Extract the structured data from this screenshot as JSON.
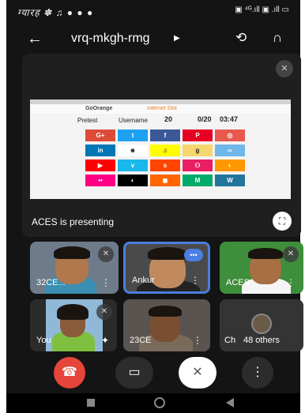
{
  "status": {
    "left": "ग्यारह ✽ ♫ ● ● ●",
    "right": "▣ ⁴ᴳ.ıll ▣ .ıll ▭"
  },
  "topbar": {
    "meeting_code": "vrq-mkgh-rmg",
    "back_icon": "arrow-left-icon",
    "switch_camera_icon": "camera-switch-icon",
    "audio_icon": "headphones-icon"
  },
  "presentation": {
    "label": "ACES is presenting",
    "screen": {
      "brand": "GoOrange",
      "section": "Internet Slot",
      "pretest": "Pretest",
      "user": "Username",
      "score": "20",
      "progress": "0/20",
      "timer": "03:47",
      "cells": [
        {
          "text": "G+",
          "color": "#dd4b39"
        },
        {
          "text": "t",
          "color": "#1da1f2"
        },
        {
          "text": "f",
          "color": "#3b5998"
        },
        {
          "text": "P",
          "color": "#e60023"
        },
        {
          "text": "◎",
          "color": "#e95950"
        },
        {
          "text": "in",
          "color": "#0077b5"
        },
        {
          "text": "☻",
          "color": "#ffffff"
        },
        {
          "text": "♫",
          "color": "#fffc00"
        },
        {
          "text": "g",
          "color": "#f5d76e"
        },
        {
          "text": "∞",
          "color": "#6fb7e9"
        },
        {
          "text": "▶",
          "color": "#ff0000"
        },
        {
          "text": "v",
          "color": "#1ab7ea"
        },
        {
          "text": "s",
          "color": "#ff4500"
        },
        {
          "text": "⚇",
          "color": "#e91e63"
        },
        {
          "text": "◐",
          "color": "#ff9800"
        },
        {
          "text": "••",
          "color": "#ff0084"
        },
        {
          "text": "◐",
          "color": "#000000"
        },
        {
          "text": "◼",
          "color": "#ff6600"
        },
        {
          "text": "M",
          "color": "#00ab6c"
        },
        {
          "text": "W",
          "color": "#21759b"
        }
      ]
    }
  },
  "tiles": [
    {
      "name": "32CE...",
      "muted": true
    },
    {
      "name": "Ankur",
      "speaking": true
    },
    {
      "name": "ACES",
      "muted": true
    },
    {
      "name": "You",
      "muted": true
    },
    {
      "name": "23CE"
    },
    {
      "name": "Ch",
      "others": "48 others"
    }
  ],
  "controls": {
    "end": "end-call-icon",
    "camera": "camera-icon",
    "mic": "mic-off-icon",
    "more": "more-icon"
  }
}
